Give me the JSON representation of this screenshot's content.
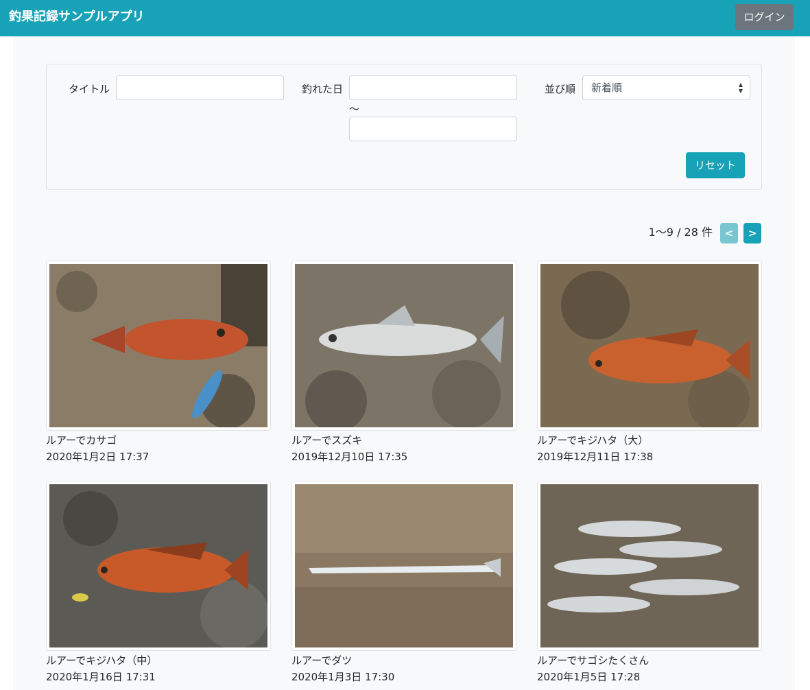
{
  "header": {
    "app_title": "釣果記録サンプルアプリ",
    "login_label": "ログイン"
  },
  "filter": {
    "title_label": "タイトル",
    "title_value": "",
    "date_label": "釣れた日",
    "date_from_value": "",
    "date_separator": "〜",
    "date_to_value": "",
    "sort_label": "並び順",
    "sort_selected": "新着順",
    "reset_label": "リセット"
  },
  "pagination": {
    "summary": "1〜9 / 28 件",
    "prev_label": "<",
    "next_label": ">"
  },
  "colors": {
    "primary": "#17a2b8",
    "secondary": "#6c757d",
    "page_bg": "#f8f9fa"
  },
  "records": [
    {
      "title": "ルアーでカサゴ",
      "date": "2020年1月2日 17:37",
      "photo": "rock-fish-kasago"
    },
    {
      "title": "ルアーでスズキ",
      "date": "2019年12月10日 17:35",
      "photo": "sea-bass-suzuki"
    },
    {
      "title": "ルアーでキジハタ（大）",
      "date": "2019年12月11日 17:38",
      "photo": "grouper-large"
    },
    {
      "title": "ルアーでキジハタ（中）",
      "date": "2020年1月16日 17:31",
      "photo": "grouper-medium"
    },
    {
      "title": "ルアーでダツ",
      "date": "2020年1月3日 17:30",
      "photo": "needlefish-datsu"
    },
    {
      "title": "ルアーでサゴシたくさん",
      "date": "2020年1月5日 17:28",
      "photo": "spanish-mackerel-many"
    }
  ]
}
